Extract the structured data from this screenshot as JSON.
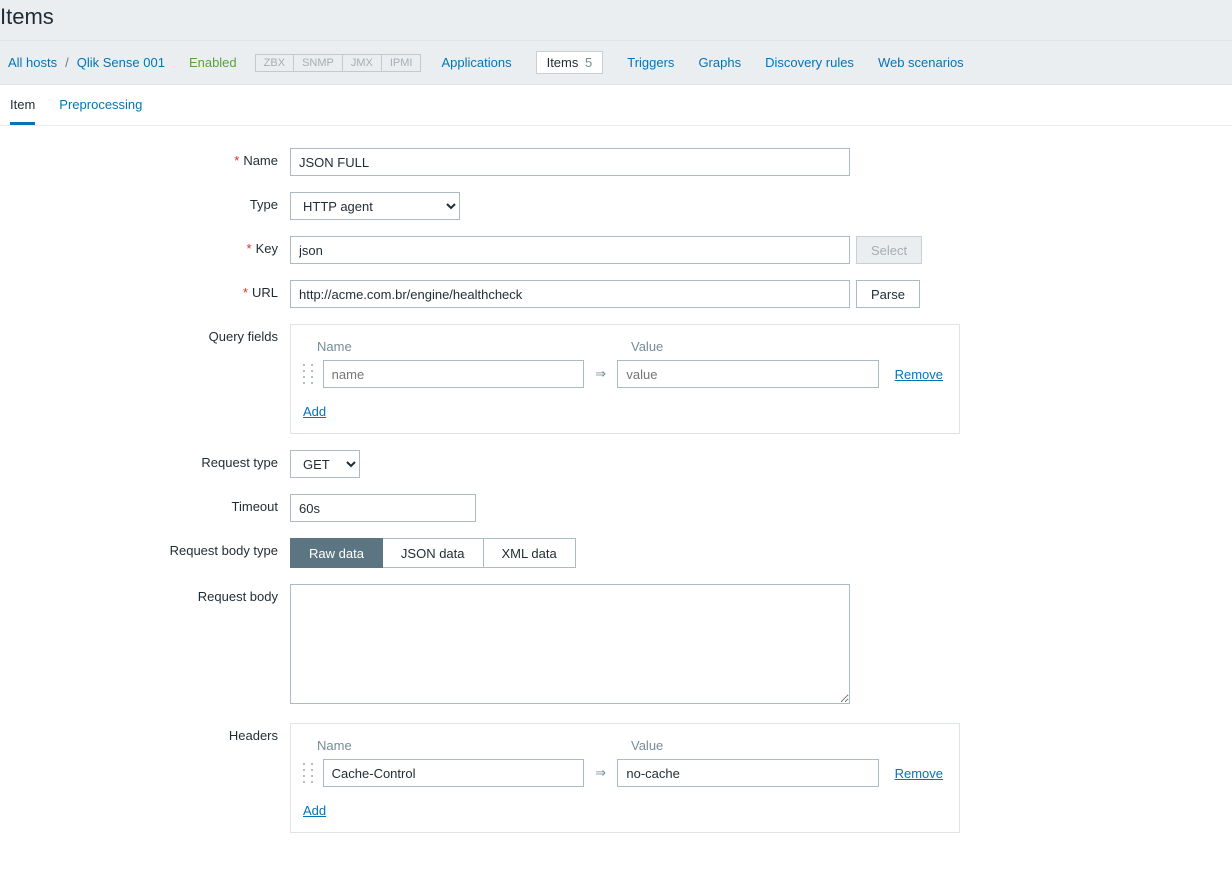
{
  "header": {
    "title": "Items"
  },
  "breadcrumb": {
    "all_hosts": "All hosts",
    "host": "Qlik Sense 001"
  },
  "status": "Enabled",
  "interfaces": [
    "ZBX",
    "SNMP",
    "JMX",
    "IPMI"
  ],
  "menu": {
    "applications": "Applications",
    "items": "Items",
    "items_count": "5",
    "triggers": "Triggers",
    "graphs": "Graphs",
    "discovery": "Discovery rules",
    "web": "Web scenarios"
  },
  "tabs": {
    "item": "Item",
    "preprocessing": "Preprocessing"
  },
  "form": {
    "labels": {
      "name": "Name",
      "type": "Type",
      "key": "Key",
      "url": "URL",
      "query_fields": "Query fields",
      "request_type": "Request type",
      "timeout": "Timeout",
      "request_body_type": "Request body type",
      "request_body": "Request body",
      "headers": "Headers"
    },
    "name": "JSON FULL",
    "type": "HTTP agent",
    "key": "json",
    "url": "http://acme.com.br/engine/healthcheck",
    "select_btn": "Select",
    "parse_btn": "Parse",
    "kv": {
      "name_header": "Name",
      "value_header": "Value",
      "name_placeholder": "name",
      "value_placeholder": "value",
      "remove": "Remove",
      "add": "Add"
    },
    "request_type": "GET",
    "timeout": "60s",
    "body_types": {
      "raw": "Raw data",
      "json": "JSON data",
      "xml": "XML data"
    },
    "request_body": "",
    "headers": [
      {
        "name": "Cache-Control",
        "value": "no-cache"
      }
    ]
  }
}
